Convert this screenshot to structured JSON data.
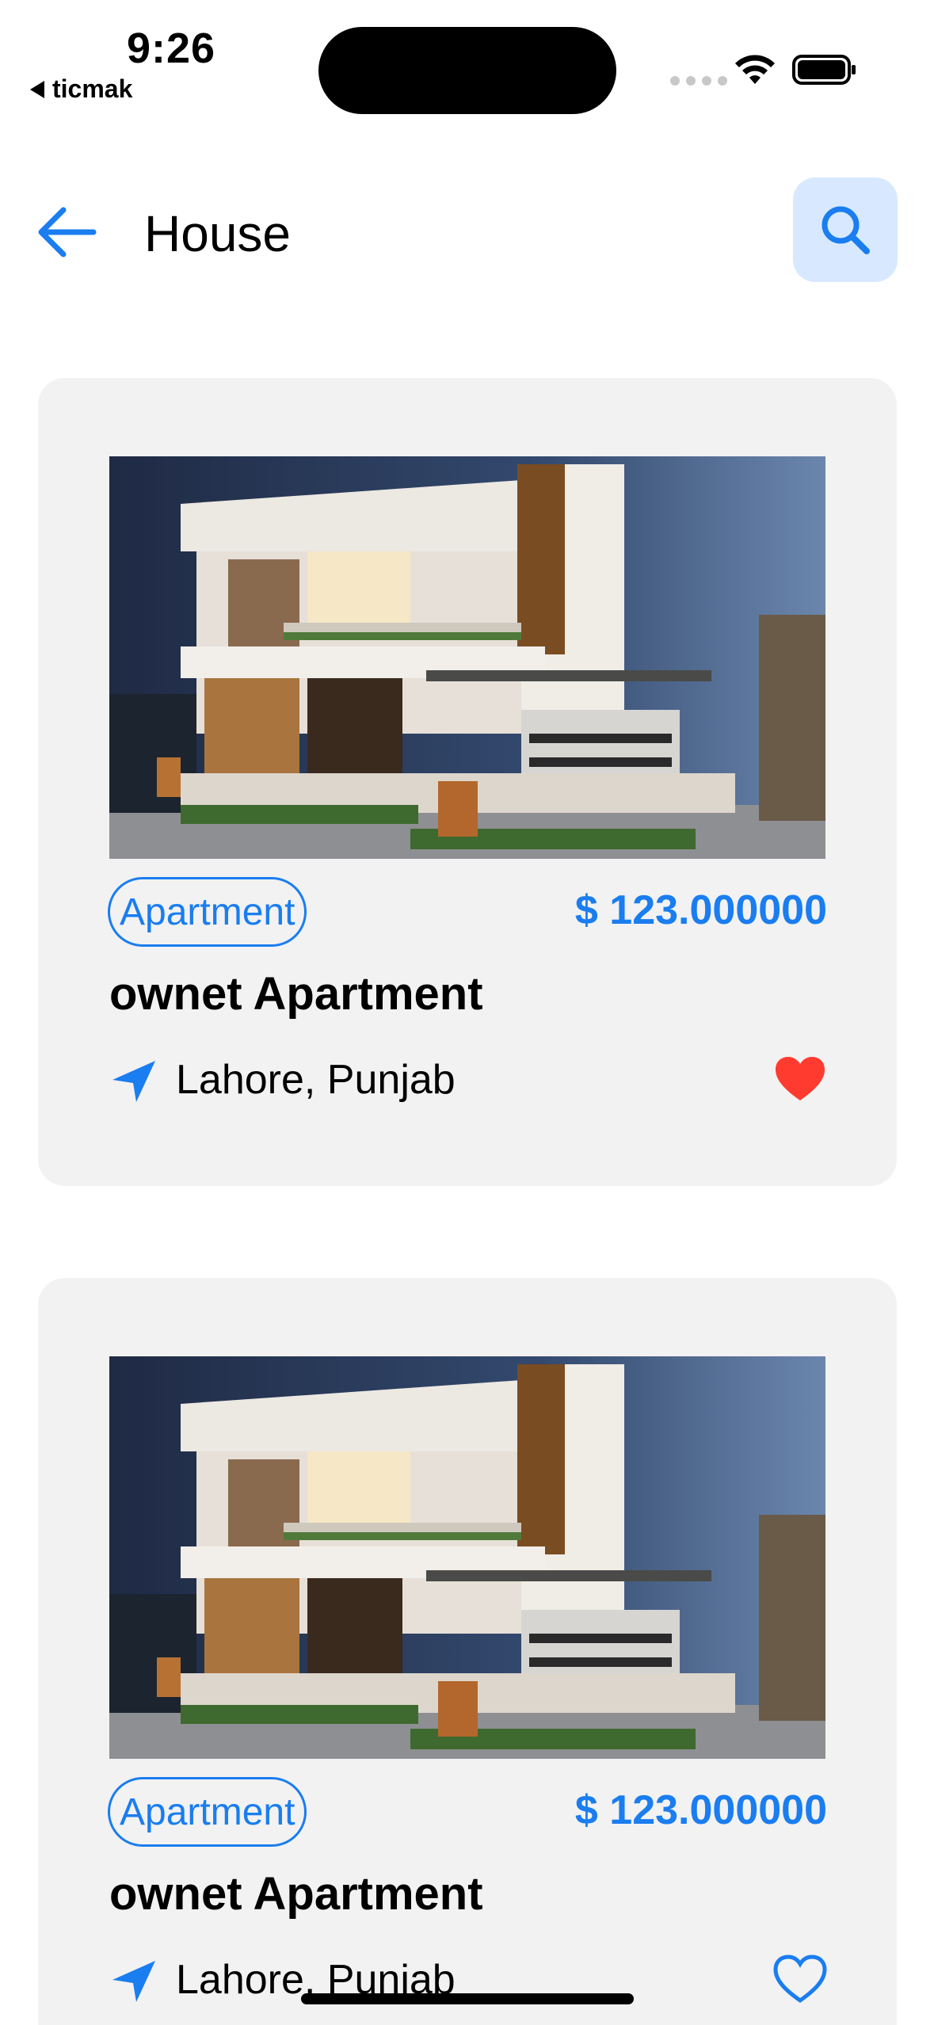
{
  "status_bar": {
    "time": "9:26",
    "back_app": "ticmak"
  },
  "header": {
    "title": "House",
    "back_icon": "arrow-left-icon",
    "search_icon": "search-icon",
    "search_bg": "#d8e9ff"
  },
  "listings": [
    {
      "image": "house-photo",
      "category": "Apartment",
      "price": "$ 123.000000",
      "title": "ownet Apartment",
      "location": "Lahore, Punjab",
      "favorite": true
    },
    {
      "image": "house-photo",
      "category": "Apartment",
      "price": "$ 123.000000",
      "title": "ownet Apartment",
      "location": "Lahore, Punjab",
      "favorite": false
    }
  ],
  "colors": {
    "accent": "#1a7df0",
    "card_bg": "#f2f2f2",
    "heart_active": "#ff3b30"
  }
}
